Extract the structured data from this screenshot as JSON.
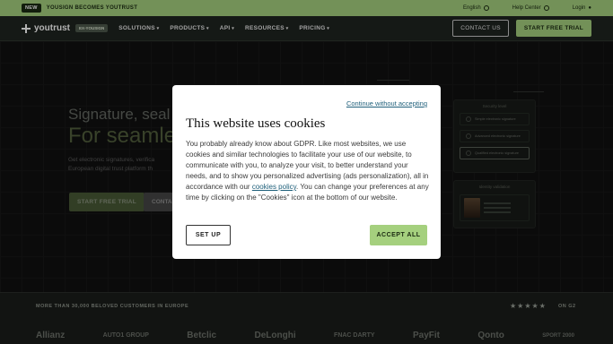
{
  "topbar": {
    "badge": "NEW",
    "announcement": "YOUSIGN BECOMES YOUTRUST",
    "language": "English",
    "help": "Help Center",
    "login": "Login"
  },
  "nav": {
    "logo": "youtrust",
    "badge": "EX-YOUSIGN",
    "menu": [
      "SOLUTIONS",
      "PRODUCTS",
      "API",
      "RESOURCES",
      "PRICING"
    ],
    "contact": "CONTACT US",
    "start": "START FREE TRIAL"
  },
  "hero": {
    "line1": "Signature, seal a",
    "line2": "For seamle",
    "desc": "Get electronic signatures, verifica European digital trust platform th",
    "start": "START FREE TRIAL",
    "contact": "CONTA",
    "security_card": {
      "title": "Security level",
      "options": [
        "Simple electronic signature",
        "Advanced electronic signature",
        "Qualified electronic signature"
      ]
    },
    "identity_card": {
      "title": "Identity validation"
    }
  },
  "customers": {
    "label": "MORE THAN 30,000 BELOVED CUSTOMERS IN EUROPE",
    "stars": "★★★★★",
    "rating_source": "ON G2",
    "logos": [
      "Allianz",
      "AUTO1 GROUP",
      "Betclic",
      "DeLonghi",
      "FNAC DARTY",
      "PayFit",
      "Qonto",
      "SPORT 2000"
    ]
  },
  "modal": {
    "continue": "Continue without accepting",
    "title": "This website uses cookies",
    "body_before": "You probably already know about GDPR. Like most websites, we use cookies and similar technologies to facilitate your use of our website, to communicate with you, to analyze your visit, to better understand your needs, and to show you personalized advertising (ads personalization), all in accordance with our ",
    "link": "cookies policy",
    "body_after": ". You can change your preferences at any time by clicking on the \"Cookies\" icon at the bottom of our website.",
    "setup": "SET UP",
    "accept": "ACCEPT ALL"
  },
  "colors": {
    "accent": "#a5d07e",
    "link": "#1e5f7a"
  }
}
